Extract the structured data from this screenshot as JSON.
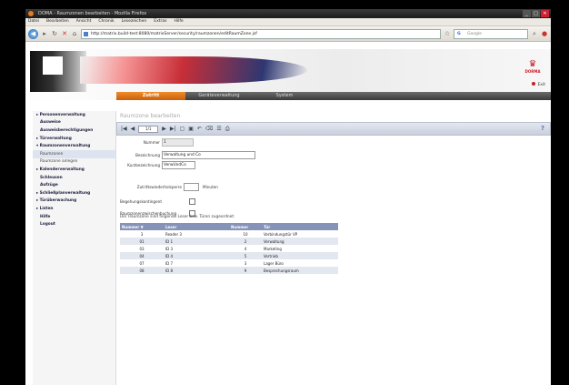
{
  "window": {
    "title": "DOMA - Raumzonen bearbeiten - Mozilla Firefox",
    "buttons": [
      "_",
      "□",
      "✕"
    ]
  },
  "menubar": [
    "Datei",
    "Bearbeiten",
    "Ansicht",
    "Chronik",
    "Lesezeichen",
    "Extras",
    "Hilfe"
  ],
  "navbar": {
    "url": "http://matrix.build-test:8080/matrixServer/security/raumzonen/editRaumZone.jsf",
    "search_placeholder": "Google"
  },
  "header": {
    "tabs": [
      {
        "label": "Zutritt",
        "active": true
      },
      {
        "label": "Geräteverwaltung",
        "active": false
      },
      {
        "label": "System",
        "active": false
      }
    ],
    "brand": "DORMA",
    "exit_label": "Exit"
  },
  "sidebar": {
    "items": [
      {
        "label": "Personenverwaltung",
        "kind": "group"
      },
      {
        "label": "Ausweise",
        "kind": "sub"
      },
      {
        "label": "Ausweisberechtigungen",
        "kind": "sub"
      },
      {
        "label": "Türverwaltung",
        "kind": "group"
      },
      {
        "label": "Raumzonenverwaltung",
        "kind": "group"
      },
      {
        "label": "Raumzonen",
        "kind": "plain",
        "highlight": true
      },
      {
        "label": "Raumzone anlegen",
        "kind": "plain"
      },
      {
        "label": "Kalenderverwaltung",
        "kind": "group"
      },
      {
        "label": "Schleusen",
        "kind": "sub"
      },
      {
        "label": "Aufzüge",
        "kind": "sub"
      },
      {
        "label": "Schließplanverwaltung",
        "kind": "group"
      },
      {
        "label": "Türüberwachung",
        "kind": "group"
      },
      {
        "label": "Listen",
        "kind": "group"
      },
      {
        "label": "Hilfe",
        "kind": "sub"
      },
      {
        "label": "Logout",
        "kind": "sub"
      }
    ]
  },
  "page": {
    "title": "Raumzone bearbeiten",
    "pager_value": "1/1",
    "help_label": "?",
    "form": {
      "nummer_label": "Nummer",
      "nummer_value": "1",
      "bezeichnung_label": "Bezeichnung",
      "bezeichnung_value": "Verwaltung und Co",
      "kurz_label": "Kurzbezeichnung",
      "kurz_value": "VerwUndCo",
      "zutritt_label": "Zutrittswiederholsperre",
      "zutritt_unit": "Minuten",
      "begehung_label": "Begehungskontingent",
      "raumzonen_label": "Raumzonenzwischenbuchung"
    },
    "table_note": "Der Raumzone sind folgende Leser bzw. Türen zugeordnet:",
    "table": {
      "headers": [
        "Nummer ▼",
        "Leser",
        "Nummer",
        "Tür"
      ],
      "rows": [
        [
          "3",
          "Reader 3",
          "10",
          "Verbindungstür VP"
        ],
        [
          "01",
          "ID 1",
          "2",
          "Verwaltung"
        ],
        [
          "03",
          "ID 3",
          "4",
          "Marketing"
        ],
        [
          "04",
          "ID 4",
          "5",
          "Vertrieb"
        ],
        [
          "07",
          "ID 7",
          "3",
          "Lager Büro"
        ],
        [
          "08",
          "ID 8",
          "9",
          "Besprechungsraum"
        ]
      ]
    }
  }
}
